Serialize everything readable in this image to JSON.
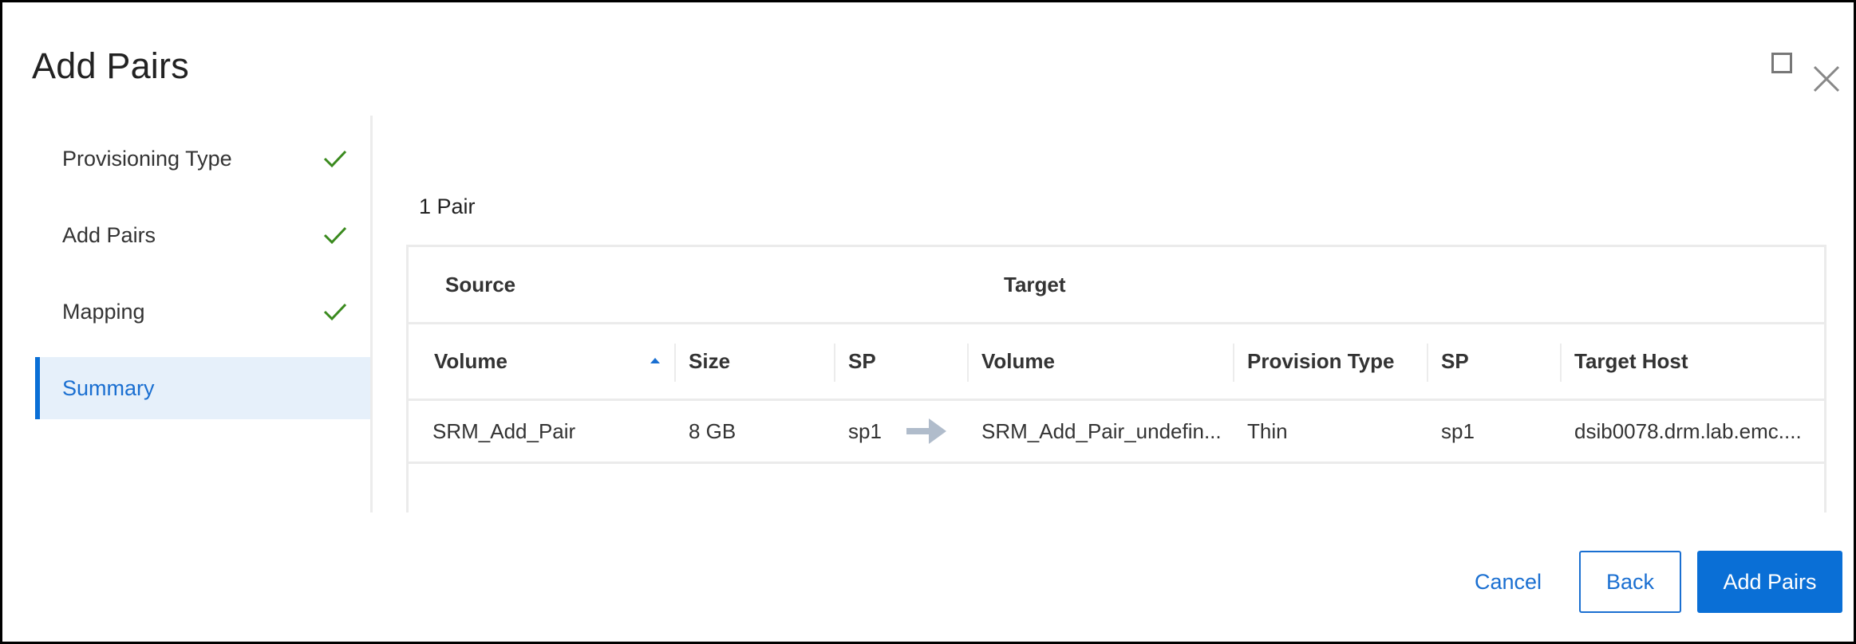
{
  "dialog": {
    "title": "Add Pairs",
    "maximize_icon": "maximize-icon",
    "close_icon": "close-icon"
  },
  "steps": [
    {
      "label": "Provisioning Type",
      "completed": true,
      "active": false
    },
    {
      "label": "Add Pairs",
      "completed": true,
      "active": false
    },
    {
      "label": "Mapping",
      "completed": true,
      "active": false
    },
    {
      "label": "Summary",
      "completed": false,
      "active": true
    }
  ],
  "summary": {
    "pair_count": "1 Pair",
    "groups": {
      "source": "Source",
      "target": "Target"
    },
    "columns": [
      "Volume",
      "Size",
      "SP",
      "Volume",
      "Provision Type",
      "SP",
      "Target Host"
    ],
    "sort": {
      "column": "Volume",
      "direction": "ascending"
    },
    "rows": [
      {
        "source_volume": "SRM_Add_Pair",
        "size": "8 GB",
        "source_sp": "sp1",
        "target_volume": "SRM_Add_Pair_undefin...",
        "provision_type": "Thin",
        "target_sp": "sp1",
        "target_host": "dsib0078.drm.lab.emc...."
      }
    ]
  },
  "buttons": {
    "cancel": "Cancel",
    "back": "Back",
    "submit": "Add Pairs"
  },
  "colors": {
    "accent": "#0a6fd6",
    "check": "#3a8a1e",
    "active_bg": "#e6f0fa",
    "arrow": "#b0bccb"
  }
}
